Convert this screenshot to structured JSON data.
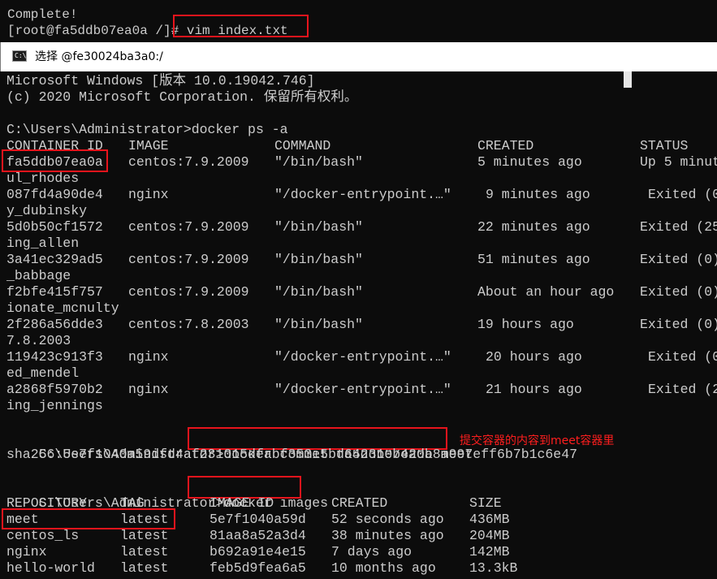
{
  "background_terminal": {
    "line1": "Complete!",
    "line2": "[root@fa5ddb07ea0a /]# vim index.txt"
  },
  "window": {
    "title": "选择 @fe30024ba3a0:/",
    "icon": "cmd-icon",
    "icon_text": "C:\\"
  },
  "console": {
    "banner1": "Microsoft Windows [版本 10.0.19042.746]",
    "banner2": "(c) 2020 Microsoft Corporation. 保留所有权利。",
    "prompt1": "C:\\Users\\Administrator>docker ps -a",
    "ps_headers": [
      "CONTAINER ID",
      "IMAGE",
      "COMMAND",
      "CREATED",
      "STATUS"
    ],
    "ps_rows": [
      {
        "id": "fa5ddb07ea0a",
        "image": "centos:7.9.2009",
        "command": "\"/bin/bash\"",
        "created": "5 minutes ago",
        "status": "Up 5 minut",
        "name": "ul_rhodes"
      },
      {
        "id": "087fd4a90de4",
        "image": "nginx",
        "command": "\"/docker-entrypoint.…\"",
        "created": "9 minutes ago",
        "status": "Exited (0",
        "name": "y_dubinsky"
      },
      {
        "id": "5d0b50cf1572",
        "image": "centos:7.9.2009",
        "command": "\"/bin/bash\"",
        "created": "22 minutes ago",
        "status": "Exited (25",
        "name": "ing_allen"
      },
      {
        "id": "3a41ec329ad5",
        "image": "centos:7.9.2009",
        "command": "\"/bin/bash\"",
        "created": "51 minutes ago",
        "status": "Exited (0)",
        "name": "_babbage"
      },
      {
        "id": "f2bfe415f757",
        "image": "centos:7.9.2009",
        "command": "\"/bin/bash\"",
        "created": "About an hour ago",
        "status": "Exited (0)",
        "name": "ionate_mcnulty"
      },
      {
        "id": "2f286a56dde3",
        "image": "centos:7.8.2003",
        "command": "\"/bin/bash\"",
        "created": "19 hours ago",
        "status": "Exited (0)",
        "name": "7.8.2003"
      },
      {
        "id": "119423c913f3",
        "image": "nginx",
        "command": "\"/docker-entrypoint.…\"",
        "created": "20 hours ago",
        "status": "Exited (0",
        "name": "ed_mendel"
      },
      {
        "id": "a2868f5970b2",
        "image": "nginx",
        "command": "\"/docker-entrypoint.…\"",
        "created": "21 hours ago",
        "status": "Exited (2",
        "name": "ing_jennings"
      }
    ],
    "prompt2_prefix": "C:\\Users\\Administrator>",
    "prompt2_cmd": "docker commit fa5ddb07ea0a meet",
    "annotation": "提交容器的内容到meet容器里",
    "sha": "sha256:5e7f1040a59dfd4af231015dfabf353e5bd64231eb42db8a997eff6b7b1c6e47",
    "prompt3_prefix": "C:\\Users\\Administrator>",
    "prompt3_cmd": "docker images",
    "img_headers": [
      "REPOSITORY",
      "TAG",
      "IMAGE ID",
      "CREATED",
      "SIZE"
    ],
    "img_rows": [
      {
        "repo": "meet",
        "tag": "latest",
        "id": "5e7f1040a59d",
        "created": "52 seconds ago",
        "size": "436MB"
      },
      {
        "repo": "centos_ls",
        "tag": "latest",
        "id": "81aa8a52a3d4",
        "created": "38 minutes ago",
        "size": "204MB"
      },
      {
        "repo": "nginx",
        "tag": "latest",
        "id": "b692a91e4e15",
        "created": "7 days ago",
        "size": "142MB"
      },
      {
        "repo": "hello-world",
        "tag": "latest",
        "id": "feb5d9fea6a5",
        "created": "10 months ago",
        "size": "13.3kB"
      }
    ]
  },
  "colors": {
    "console_bg": "#0c0c0c",
    "console_text": "#cccccc",
    "highlight": "#e8141c",
    "annotation": "#ff1e1e"
  }
}
